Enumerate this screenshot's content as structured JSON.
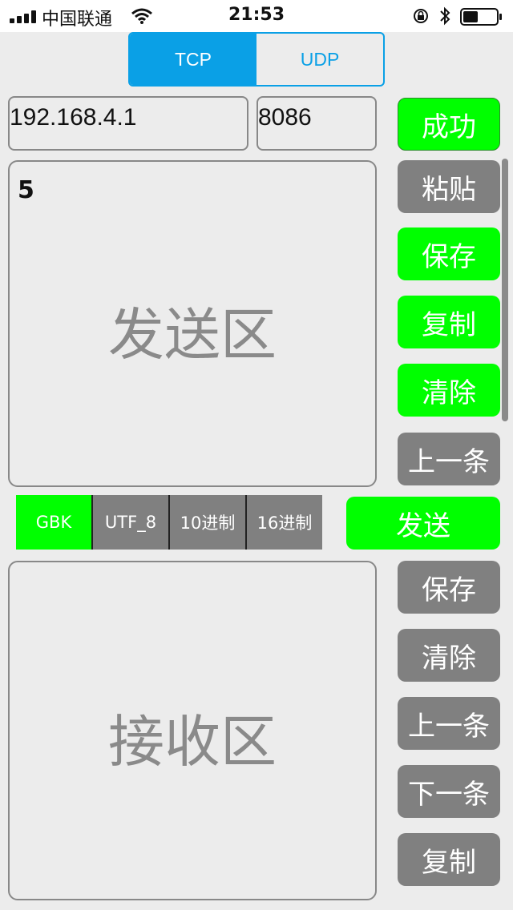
{
  "status_bar": {
    "carrier": "中国联通",
    "time": "21:53"
  },
  "protocol_tabs": [
    {
      "label": "TCP"
    },
    {
      "label": "UDP"
    }
  ],
  "connection": {
    "ip": "192.168.4.1",
    "port": "8086",
    "connect_label": "成功"
  },
  "send_area": {
    "value": "5",
    "placeholder": "发送区"
  },
  "send_buttons": {
    "paste": "粘贴",
    "save": "保存",
    "copy": "复制",
    "clear": "清除",
    "prev": "上一条"
  },
  "encodings": [
    {
      "label": "GBK"
    },
    {
      "label": "UTF_8"
    },
    {
      "label": "10进制"
    },
    {
      "label": "16进制"
    }
  ],
  "send_label": "发送",
  "receive_area": {
    "placeholder": "接收区"
  },
  "receive_buttons": {
    "save": "保存",
    "clear": "清除",
    "prev": "上一条",
    "next": "下一条",
    "copy": "复制"
  },
  "colors": {
    "accent": "#0aa0e6",
    "active": "#00ff00",
    "inactive": "#808080",
    "background": "#ececec"
  }
}
